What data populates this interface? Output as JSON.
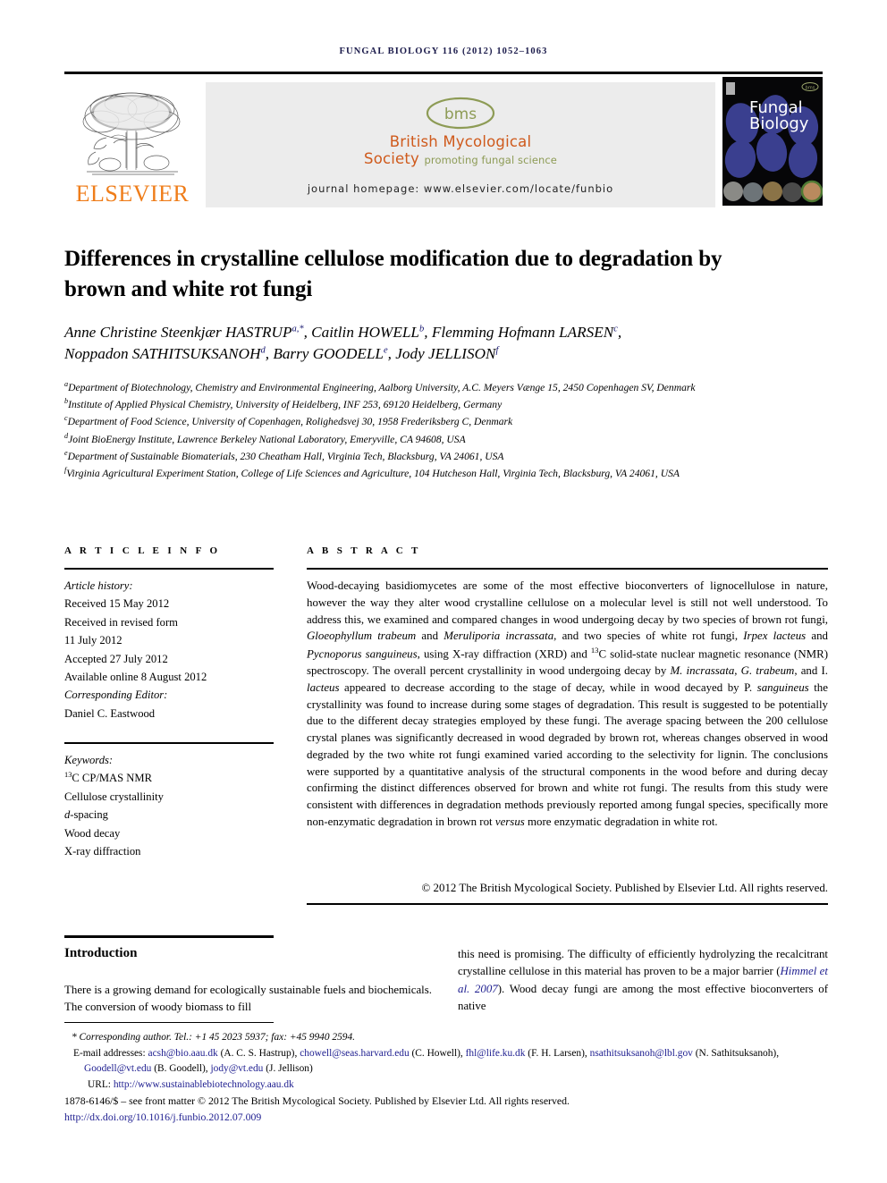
{
  "running_head": "FUNGAL BIOLOGY 116 (2012) 1052–1063",
  "masthead": {
    "publisher_word": "ELSEVIER",
    "publisher_logo_name": "elsevier-tree-logo",
    "society_mark": "bms",
    "society_line1": "British Mycological",
    "society_line2": "Society",
    "society_tagline": "promoting fungal science",
    "homepage": "journal homepage: www.elsevier.com/locate/funbio",
    "cover_title_line1": "Fungal",
    "cover_title_line2": "Biology",
    "colors": {
      "elsevier_orange": "#ef7d1a",
      "bms_orange": "#cf5a1c",
      "bms_olive": "#8d9b55",
      "banner_grey": "#ececec",
      "link_blue": "#1d1d8f"
    }
  },
  "article": {
    "title": "Differences in crystalline cellulose modification due to degradation by brown and white rot fungi",
    "authors_line1_a": "Anne Christine Steenkjær HASTRUP",
    "authors_line1_a_sup": "a,*",
    "authors_line1_b": "Caitlin HOWELL",
    "authors_line1_b_sup": "b",
    "authors_line1_c": "Flemming Hofmann LARSEN",
    "authors_line1_c_sup": "c",
    "authors_line2_d": "Noppadon SATHITSUKSANOH",
    "authors_line2_d_sup": "d",
    "authors_line2_e": "Barry GOODELL",
    "authors_line2_e_sup": "e",
    "authors_line2_f": "Jody JELLISON",
    "authors_line2_f_sup": "f",
    "affiliations": [
      {
        "mark": "a",
        "text": "Department of Biotechnology, Chemistry and Environmental Engineering, Aalborg University, A.C. Meyers Vænge 15, 2450 Copenhagen SV, Denmark"
      },
      {
        "mark": "b",
        "text": "Institute of Applied Physical Chemistry, University of Heidelberg, INF 253, 69120 Heidelberg, Germany"
      },
      {
        "mark": "c",
        "text": "Department of Food Science, University of Copenhagen, Rolighedsvej 30, 1958 Frederiksberg C, Denmark"
      },
      {
        "mark": "d",
        "text": "Joint BioEnergy Institute, Lawrence Berkeley National Laboratory, Emeryville, CA 94608, USA"
      },
      {
        "mark": "e",
        "text": "Department of Sustainable Biomaterials, 230 Cheatham Hall, Virginia Tech, Blacksburg, VA 24061, USA"
      },
      {
        "mark": "f",
        "text": "Virginia Agricultural Experiment Station, College of Life Sciences and Agriculture, 104 Hutcheson Hall, Virginia Tech, Blacksburg, VA 24061, USA"
      }
    ]
  },
  "article_info": {
    "heading": "A R T I C L E  I N F O",
    "history_label": "Article history:",
    "received": "Received 15 May 2012",
    "revised_label": "Received in revised form",
    "revised_date": "11 July 2012",
    "accepted": "Accepted 27 July 2012",
    "available": "Available online 8 August 2012",
    "editor_label": "Corresponding Editor:",
    "editor_name": "Daniel C. Eastwood",
    "keywords_label": "Keywords:",
    "keywords": [
      "13C CP/MAS NMR",
      "Cellulose crystallinity",
      "d-spacing",
      "Wood decay",
      "X-ray diffraction"
    ]
  },
  "abstract": {
    "heading": "A B S T R A C T",
    "text_part1": "Wood-decaying basidiomycetes are some of the most effective bioconverters of lignocellulose in nature, however the way they alter wood crystalline cellulose on a molecular level is still not well understood. To address this, we examined and compared changes in wood undergoing decay by two species of brown rot fungi, ",
    "sp1": "Gloeophyllum trabeum",
    "text_part2": " and ",
    "sp2": "Meruliporia incrassata",
    "text_part3": ", and two species of white rot fungi, ",
    "sp3": "Irpex lacteus",
    "text_part4": " and ",
    "sp4": "Pycnoporus sanguineus",
    "text_part5": ", using X-ray diffraction (XRD) and ",
    "sup_13": "13",
    "text_part6": "C solid-state nuclear magnetic resonance (NMR) spectroscopy. The overall percent crystallinity in wood undergoing decay by ",
    "sp5": "M. incrassata",
    "text_part7": ", ",
    "sp6": "G. trabeum",
    "text_part8": ", and I. ",
    "sp7": "lacteus",
    "text_part9": " appeared to decrease according to the stage of decay, while in wood decayed by P. ",
    "sp8": "sanguineus",
    "text_part10": " the crystallinity was found to increase during some stages of degradation. This result is suggested to be potentially due to the different decay strategies employed by these fungi. The average spacing between the 200 cellulose crystal planes was significantly decreased in wood degraded by brown rot, whereas changes observed in wood degraded by the two white rot fungi examined varied according to the selectivity for lignin. The conclusions were supported by a quantitative analysis of the structural components in the wood before and during decay confirming the distinct differences observed for brown and white rot fungi. The results from this study were consistent with differences in degradation methods previously reported among fungal species, specifically more non-enzymatic degradation in brown rot ",
    "sp9": "versus",
    "text_part11": " more enzymatic degradation in white rot.",
    "copyright": "© 2012 The British Mycological Society. Published by Elsevier Ltd. All rights reserved."
  },
  "body": {
    "intro_heading": "Introduction",
    "left_col": "There is a growing demand for ecologically sustainable fuels and biochemicals. The conversion of woody biomass to fill",
    "right_col_part1": "this need is promising. The difficulty of efficiently hydrolyzing the recalcitrant crystalline cellulose in this material has proven to be a major barrier (",
    "right_col_ref": "Himmel et al. 2007",
    "right_col_part2": "). Wood decay fungi are among the most effective bioconverters of native"
  },
  "footnote": {
    "corresponding": "* Corresponding author. Tel.: +1 45 2023 5937; fax: +45 9940 2594.",
    "emails_label": "E-mail addresses:",
    "emails": [
      {
        "address": "acsh@bio.aau.dk",
        "person": "(A. C. S.  Hastrup)"
      },
      {
        "address": "chowell@seas.harvard.edu",
        "person": "(C.  Howell)"
      },
      {
        "address": "fhl@life.ku.dk",
        "person": "(F. H.  Larsen)"
      },
      {
        "address": "nsathitsuksanoh@lbl.gov",
        "person": "(N.  Sathitsuksanoh)"
      },
      {
        "address": "Goodell@vt.edu",
        "person": "(B.  Goodell)"
      },
      {
        "address": "jody@vt.edu",
        "person": "(J.  Jellison)"
      }
    ],
    "url_label": "URL:",
    "url": "http://www.sustainablebiotechnology.aau.dk",
    "issn_line": "1878-6146/$ – see front matter © 2012 The British Mycological Society. Published by Elsevier Ltd. All rights reserved.",
    "doi": "http://dx.doi.org/10.1016/j.funbio.2012.07.009"
  }
}
